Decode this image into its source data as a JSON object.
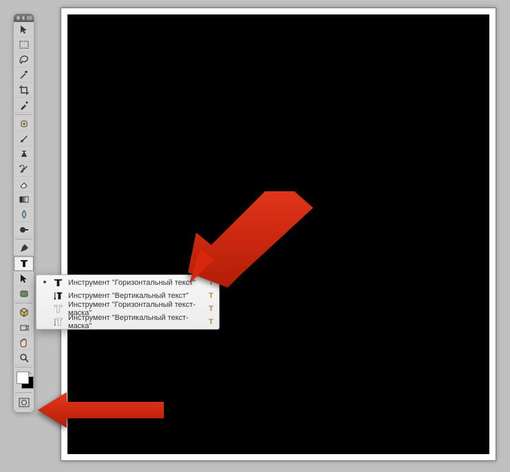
{
  "flyout": {
    "items": [
      {
        "label": "Инструмент \"Горизонтальный текст\"",
        "shortcut": "T",
        "selected": true
      },
      {
        "label": "Инструмент \"Вертикальный текст\"",
        "shortcut": "T",
        "selected": false
      },
      {
        "label": "Инструмент \"Горизонтальный текст-маска\"",
        "shortcut": "T",
        "selected": false
      },
      {
        "label": "Инструмент \"Вертикальный текст-маска\"",
        "shortcut": "T",
        "selected": false
      }
    ]
  },
  "colors": {
    "foreground": "#ffffff",
    "background": "#000000"
  }
}
